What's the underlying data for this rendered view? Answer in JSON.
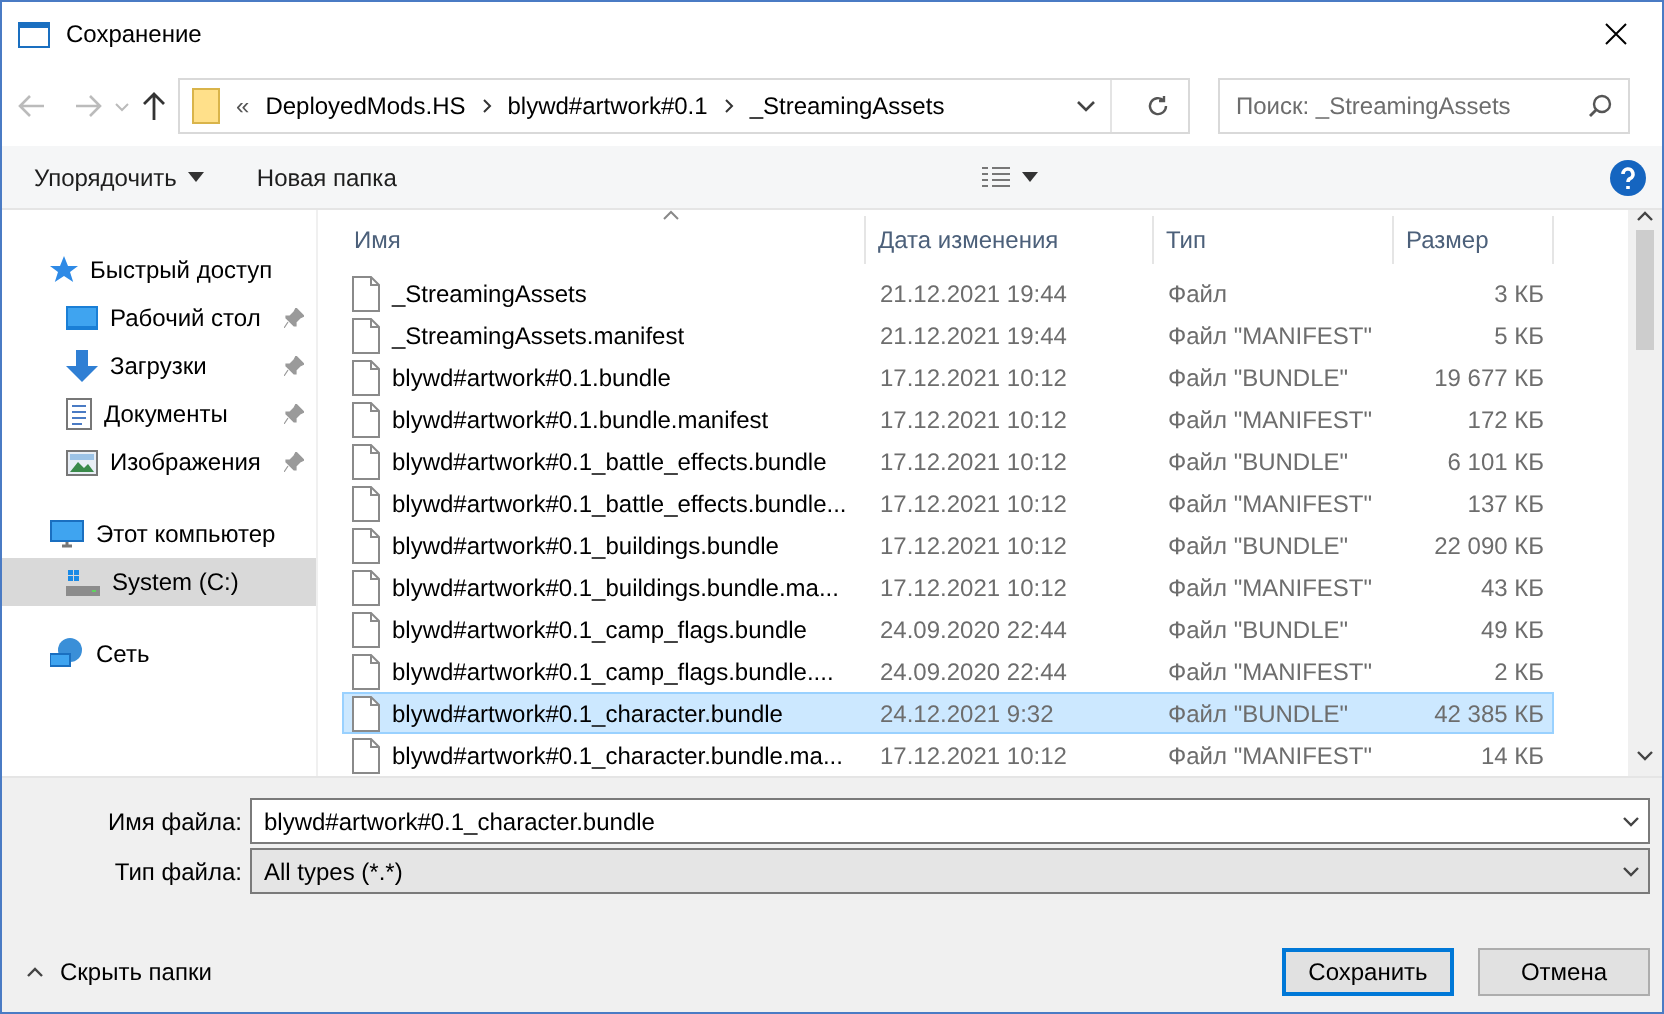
{
  "window": {
    "title": "Сохранение"
  },
  "address": {
    "overflow": "«",
    "crumbs": [
      "DeployedMods.HS",
      "blywd#artwork#0.1",
      "_StreamingAssets"
    ]
  },
  "search": {
    "placeholder": "Поиск: _StreamingAssets"
  },
  "toolbar": {
    "organize": "Упорядочить",
    "new_folder": "Новая папка"
  },
  "sidebar": {
    "items": [
      {
        "kind": "quick",
        "label": "Быстрый доступ",
        "pinned": false,
        "selected": false
      },
      {
        "kind": "desktop",
        "label": "Рабочий стол",
        "pinned": true,
        "selected": false
      },
      {
        "kind": "downloads",
        "label": "Загрузки",
        "pinned": true,
        "selected": false
      },
      {
        "kind": "documents",
        "label": "Документы",
        "pinned": true,
        "selected": false
      },
      {
        "kind": "pictures",
        "label": "Изображения",
        "pinned": true,
        "selected": false
      },
      {
        "kind": "computer",
        "label": "Этот компьютер",
        "pinned": false,
        "selected": false
      },
      {
        "kind": "drive",
        "label": "System (C:)",
        "pinned": false,
        "selected": true
      },
      {
        "kind": "network",
        "label": "Сеть",
        "pinned": false,
        "selected": false
      }
    ]
  },
  "table": {
    "columns": [
      "Имя",
      "Дата изменения",
      "Тип",
      "Размер"
    ],
    "rows": [
      {
        "name": "_StreamingAssets",
        "date": "21.12.2021 19:44",
        "type": "Файл",
        "size": "3 КБ",
        "selected": false
      },
      {
        "name": "_StreamingAssets.manifest",
        "date": "21.12.2021 19:44",
        "type": "Файл \"MANIFEST\"",
        "size": "5 КБ",
        "selected": false
      },
      {
        "name": "blywd#artwork#0.1.bundle",
        "date": "17.12.2021 10:12",
        "type": "Файл \"BUNDLE\"",
        "size": "19 677 КБ",
        "selected": false
      },
      {
        "name": "blywd#artwork#0.1.bundle.manifest",
        "date": "17.12.2021 10:12",
        "type": "Файл \"MANIFEST\"",
        "size": "172 КБ",
        "selected": false
      },
      {
        "name": "blywd#artwork#0.1_battle_effects.bundle",
        "date": "17.12.2021 10:12",
        "type": "Файл \"BUNDLE\"",
        "size": "6 101 КБ",
        "selected": false
      },
      {
        "name": "blywd#artwork#0.1_battle_effects.bundle...",
        "date": "17.12.2021 10:12",
        "type": "Файл \"MANIFEST\"",
        "size": "137 КБ",
        "selected": false
      },
      {
        "name": "blywd#artwork#0.1_buildings.bundle",
        "date": "17.12.2021 10:12",
        "type": "Файл \"BUNDLE\"",
        "size": "22 090 КБ",
        "selected": false
      },
      {
        "name": "blywd#artwork#0.1_buildings.bundle.ma...",
        "date": "17.12.2021 10:12",
        "type": "Файл \"MANIFEST\"",
        "size": "43 КБ",
        "selected": false
      },
      {
        "name": "blywd#artwork#0.1_camp_flags.bundle",
        "date": "24.09.2020 22:44",
        "type": "Файл \"BUNDLE\"",
        "size": "49 КБ",
        "selected": false
      },
      {
        "name": "blywd#artwork#0.1_camp_flags.bundle....",
        "date": "24.09.2020 22:44",
        "type": "Файл \"MANIFEST\"",
        "size": "2 КБ",
        "selected": false
      },
      {
        "name": "blywd#artwork#0.1_character.bundle",
        "date": "24.12.2021 9:32",
        "type": "Файл \"BUNDLE\"",
        "size": "42 385 КБ",
        "selected": true
      },
      {
        "name": "blywd#artwork#0.1_character.bundle.ma...",
        "date": "17.12.2021 10:12",
        "type": "Файл \"MANIFEST\"",
        "size": "14 КБ",
        "selected": false
      }
    ]
  },
  "file_name": {
    "label": "Имя файла:",
    "value": "blywd#artwork#0.1_character.bundle"
  },
  "file_type": {
    "label": "Тип файла:",
    "value": "All types (*.*)"
  },
  "hide_folders": "Скрыть папки",
  "buttons": [
    {
      "label": "Сохранить",
      "kind": "primary"
    },
    {
      "label": "Отмена",
      "kind": "normal"
    }
  ]
}
